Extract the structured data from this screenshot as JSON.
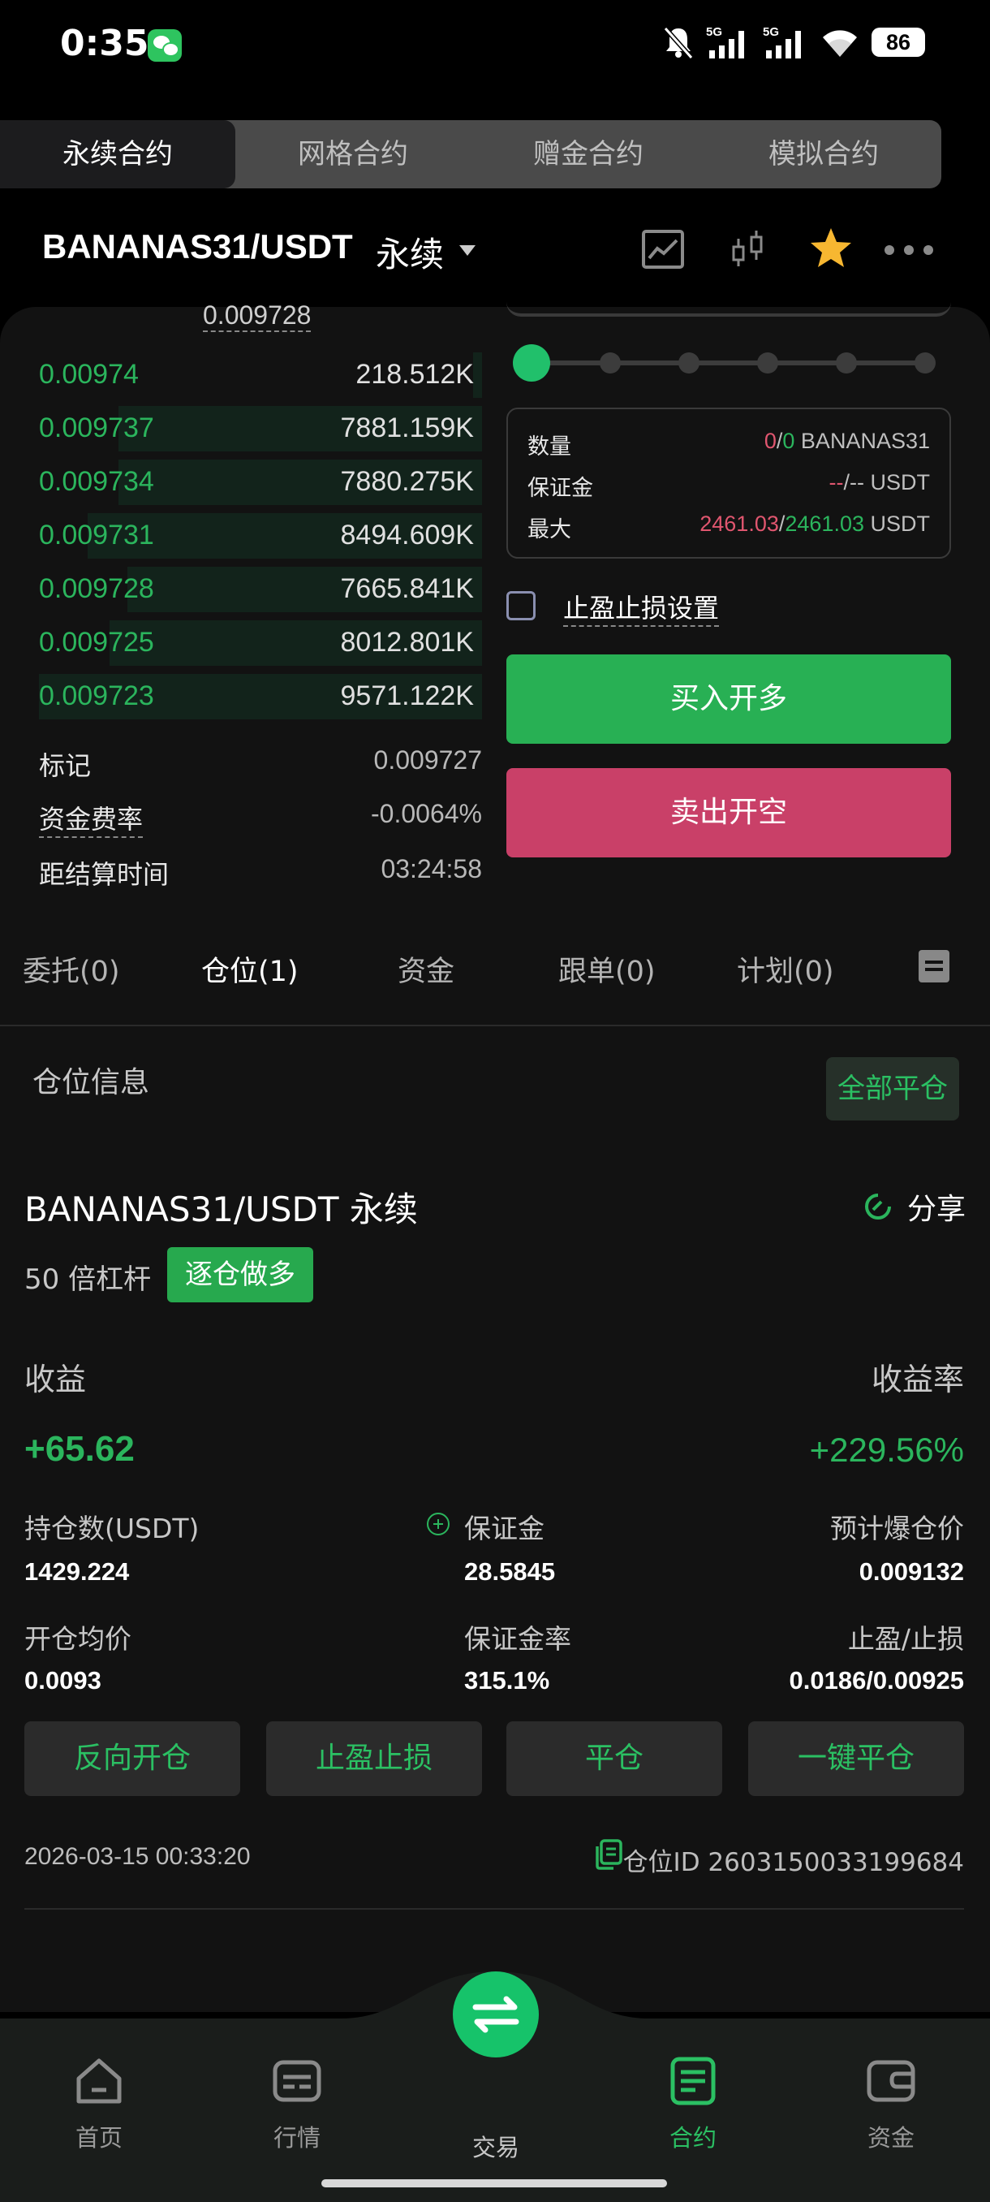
{
  "status_bar": {
    "time": "0:35",
    "battery": "86",
    "net1": "5G",
    "net2": "5G"
  },
  "top_tabs": [
    "永续合约",
    "网格合约",
    "赠金合约",
    "模拟合约"
  ],
  "header": {
    "pair": "BANANAS31/USDT",
    "type": "永续"
  },
  "orderbook": {
    "ref_price": "0.009728",
    "rows": [
      {
        "price": "0.00974",
        "qty": "218.512K",
        "depth": 0.02
      },
      {
        "price": "0.009737",
        "qty": "7881.159K",
        "depth": 0.82
      },
      {
        "price": "0.009734",
        "qty": "7880.275K",
        "depth": 0.82
      },
      {
        "price": "0.009731",
        "qty": "8494.609K",
        "depth": 0.89
      },
      {
        "price": "0.009728",
        "qty": "7665.841K",
        "depth": 0.8
      },
      {
        "price": "0.009725",
        "qty": "8012.801K",
        "depth": 0.84
      },
      {
        "price": "0.009723",
        "qty": "9571.122K",
        "depth": 1.0
      }
    ],
    "mark_label": "标记",
    "mark_value": "0.009727",
    "funding_label": "资金费率",
    "funding_value": "-0.0064%",
    "settle_label": "距结算时间",
    "settle_value": "03:24:58"
  },
  "order_form": {
    "slider_percent": 0,
    "qty_label": "数量",
    "qty_a": "0",
    "qty_sep": "/",
    "qty_b": "0",
    "qty_unit": "BANANAS31",
    "margin_label": "保证金",
    "margin_a": "--",
    "margin_sep": "/",
    "margin_b": "--",
    "margin_unit": "USDT",
    "max_label": "最大",
    "max_a": "2461.03",
    "max_sep": "/",
    "max_b": "2461.03",
    "max_unit": "USDT",
    "tpsl_label": "止盈止损设置",
    "buy_label": "买入开多",
    "sell_label": "卖出开空"
  },
  "sub_tabs": {
    "orders": "委托(0)",
    "positions": "仓位(1)",
    "assets": "资金",
    "copy": "跟单(0)",
    "plans": "计划(0)"
  },
  "position": {
    "section_title": "仓位信息",
    "close_all": "全部平仓",
    "pair": "BANANAS31/USDT 永续",
    "share": "分享",
    "leverage": "50 倍杠杆",
    "mode": "逐仓做多",
    "pnl_label": "收益",
    "pnl_rate_label": "收益率",
    "pnl": "+65.62",
    "pnl_rate": "+229.56%",
    "size_label": "持仓数(USDT)",
    "size": "1429.224",
    "margin_label": "保证金",
    "margin": "28.5845",
    "liq_label": "预计爆仓价",
    "liq": "0.009132",
    "entry_label": "开仓均价",
    "entry": "0.0093",
    "margin_ratio_label": "保证金率",
    "margin_ratio": "315.1%",
    "tpsl_label": "止盈/止损",
    "tpsl": "0.0186/0.00925",
    "actions": [
      "反向开仓",
      "止盈止损",
      "平仓",
      "一键平仓"
    ],
    "time": "2026-03-15 00:33:20",
    "pos_id": "仓位ID 2603150033199684"
  },
  "bottom_nav": {
    "home": "首页",
    "market": "行情",
    "trade": "交易",
    "futures": "合约",
    "assets": "资金"
  },
  "colors": {
    "green": "#2bb55d",
    "red": "#c94068",
    "accent": "#16c36a"
  }
}
